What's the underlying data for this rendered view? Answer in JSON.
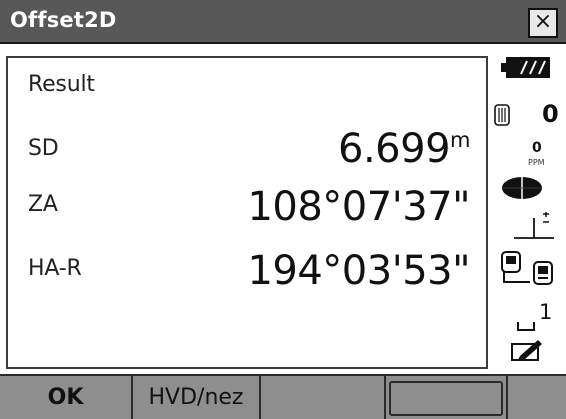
{
  "window": {
    "title": "Offset2D",
    "close_label": "×"
  },
  "main": {
    "heading": "Result",
    "rows": [
      {
        "label": "SD",
        "value": "6.699",
        "unit": "m"
      },
      {
        "label": "ZA",
        "value": "108°07'37\""
      },
      {
        "label": "HA-R",
        "value": "194°03'53\""
      }
    ]
  },
  "status": {
    "counter_value": "0",
    "ppm_value": "0",
    "ppm_label": "PPM",
    "memory_value": "1"
  },
  "softkeys": [
    {
      "label": "OK"
    },
    {
      "label": "HVD/nez"
    },
    {
      "label": ""
    },
    {
      "label": ""
    },
    {
      "label": ""
    }
  ],
  "colors": {
    "titlebar": "#585858",
    "softkey_bar": "#8e8e8e",
    "panel_bg": "#ffffff"
  }
}
